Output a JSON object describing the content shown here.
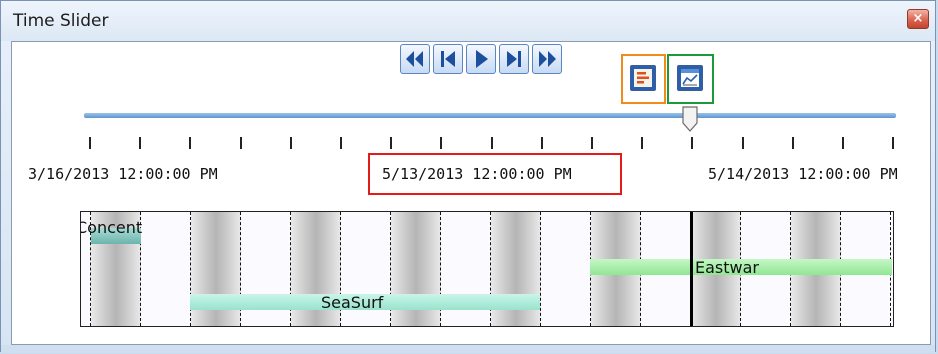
{
  "window": {
    "title": "Time Slider",
    "close_glyph": "×"
  },
  "toolbar": {
    "buttons": [
      {
        "icon": "skip-to-start-icon"
      },
      {
        "icon": "step-back-icon"
      },
      {
        "icon": "play-icon"
      },
      {
        "icon": "step-forward-icon"
      },
      {
        "icon": "skip-to-end-icon"
      },
      {
        "icon": "layer-options-icon"
      },
      {
        "icon": "time-chart-icon"
      }
    ]
  },
  "slider": {
    "position_percent": 75.5
  },
  "dates": {
    "start": "3/16/2013 12:00:00 PM",
    "current": "5/13/2013 12:00:00 PM",
    "end": "5/14/2013 12:00:00 PM"
  },
  "timeline": {
    "layers": [
      {
        "label": "Concent",
        "color": "#7ec3bd"
      },
      {
        "label": "SeaSurf",
        "color": "#a8ead7"
      },
      {
        "label": "Eastwar",
        "color": "#9eefa0"
      }
    ]
  },
  "colors": {
    "highlight_orange": "#f28a1e",
    "highlight_green": "#1c9a3a",
    "highlight_red": "#e31b1b"
  }
}
